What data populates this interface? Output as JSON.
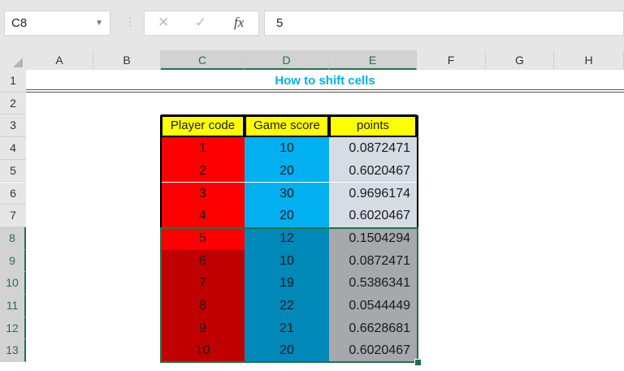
{
  "name_box": {
    "value": "C8"
  },
  "formula_bar": {
    "cancel_icon": "✕",
    "enter_icon": "✓",
    "fx_label": "fx",
    "value": "5"
  },
  "columns": [
    "A",
    "B",
    "C",
    "D",
    "E",
    "F",
    "G",
    "H"
  ],
  "selected_columns": [
    "C",
    "D",
    "E"
  ],
  "rows": [
    "1",
    "2",
    "3",
    "4",
    "5",
    "6",
    "7",
    "8",
    "9",
    "10",
    "11",
    "12",
    "13"
  ],
  "selected_rows": [
    "8",
    "9",
    "10",
    "11",
    "12",
    "13"
  ],
  "sheet_title": "How to shift cells",
  "table": {
    "headers": [
      "Player code",
      "Game score",
      "points"
    ],
    "rows": [
      [
        "1",
        "10",
        "0.0872471"
      ],
      [
        "2",
        "20",
        "0.6020467"
      ],
      [
        "3",
        "30",
        "0.9696174"
      ],
      [
        "4",
        "20",
        "0.6020467"
      ],
      [
        "5",
        "12",
        "0.1504294"
      ],
      [
        "6",
        "10",
        "0.0872471"
      ],
      [
        "7",
        "19",
        "0.5386341"
      ],
      [
        "8",
        "22",
        "0.0544449"
      ],
      [
        "9",
        "21",
        "0.6628681"
      ],
      [
        "10",
        "20",
        "0.6020467"
      ]
    ]
  },
  "colors": {
    "header": "#ffff00",
    "title": "#00b0f0",
    "red": "#ff0000",
    "dark_red": "#c00000",
    "blue": "#00b0f0",
    "dark_blue": "#0088b8",
    "light_gray": "#d6dce4",
    "gray": "#a6a8ac",
    "selection": "#217346"
  }
}
